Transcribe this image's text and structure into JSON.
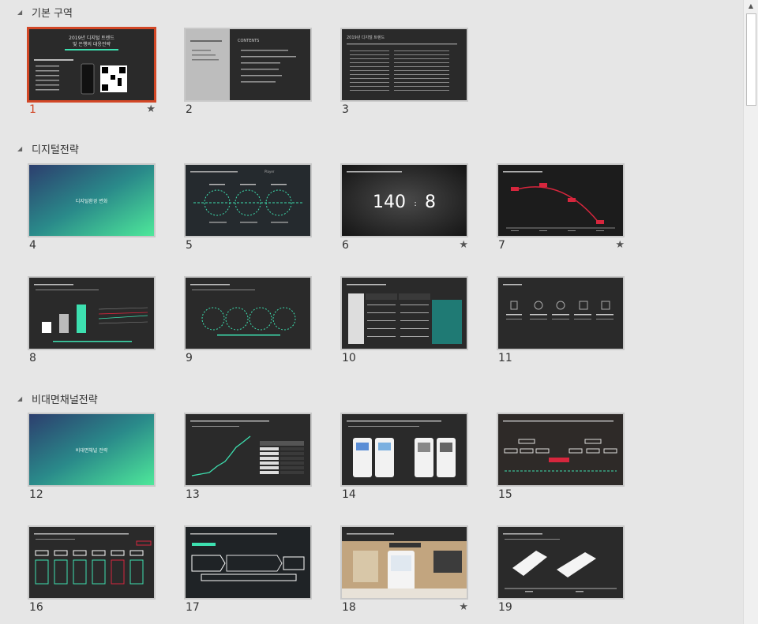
{
  "sections": [
    {
      "title": "기본 구역"
    },
    {
      "title": "디지털전략"
    },
    {
      "title": "비대면채널전략"
    }
  ],
  "slides": [
    {
      "number": "1",
      "star": "★",
      "text": [
        "2019년 디지털 트렌드",
        "및 은행의 대응전략"
      ]
    },
    {
      "number": "2",
      "star": "",
      "text": [
        "CONTENTS"
      ]
    },
    {
      "number": "3",
      "star": "",
      "text": [
        "2019년 디지털 트렌드"
      ]
    },
    {
      "number": "4",
      "star": "",
      "text": [
        "디지털환경 변화"
      ]
    },
    {
      "number": "5",
      "star": "",
      "text": [
        "Player"
      ]
    },
    {
      "number": "6",
      "star": "★",
      "text": [
        "140",
        ":",
        "8"
      ]
    },
    {
      "number": "7",
      "star": "★",
      "text": []
    },
    {
      "number": "8",
      "star": "",
      "text": []
    },
    {
      "number": "9",
      "star": "",
      "text": []
    },
    {
      "number": "10",
      "star": "",
      "text": []
    },
    {
      "number": "11",
      "star": "",
      "text": []
    },
    {
      "number": "12",
      "star": "",
      "text": [
        "비대면채널 전략"
      ]
    },
    {
      "number": "13",
      "star": "",
      "text": []
    },
    {
      "number": "14",
      "star": "",
      "text": []
    },
    {
      "number": "15",
      "star": "",
      "text": []
    },
    {
      "number": "16",
      "star": "",
      "text": []
    },
    {
      "number": "17",
      "star": "",
      "text": []
    },
    {
      "number": "18",
      "star": "★",
      "text": []
    },
    {
      "number": "19",
      "star": "",
      "text": []
    }
  ],
  "icons": {
    "collapse": "collapse-triangle-icon",
    "star": "star-icon",
    "scroll_up": "scroll-up-arrow-icon"
  },
  "colors": {
    "selection": "#d24726",
    "slide_dark": "#2a2a2a",
    "accent_teal": "#3de0b0"
  }
}
